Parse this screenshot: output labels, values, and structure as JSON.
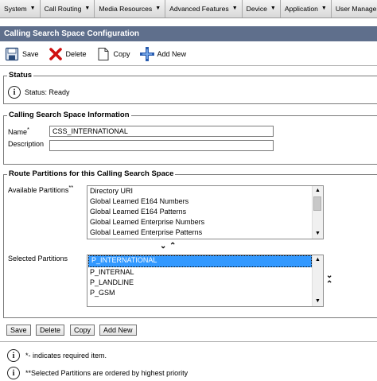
{
  "menu": {
    "items": [
      {
        "label": "System"
      },
      {
        "label": "Call Routing"
      },
      {
        "label": "Media Resources"
      },
      {
        "label": "Advanced Features"
      },
      {
        "label": "Device"
      },
      {
        "label": "Application"
      },
      {
        "label": "User Managem"
      }
    ]
  },
  "page_title": "Calling Search Space Configuration",
  "toolbar": {
    "save": "Save",
    "delete": "Delete",
    "copy": "Copy",
    "add_new": "Add New"
  },
  "status": {
    "heading": "Status",
    "text": "Status: Ready"
  },
  "css_info": {
    "heading": "Calling Search Space Information",
    "name_label": "Name",
    "name_required": "*",
    "name_value": "CSS_INTERNATIONAL",
    "description_label": "Description",
    "description_value": ""
  },
  "partitions": {
    "heading": "Route Partitions for this Calling Search Space",
    "available_label": "Available Partitions",
    "available_marker": "**",
    "available": [
      "Directory URI",
      "Global Learned E164 Numbers",
      "Global Learned E164 Patterns",
      "Global Learned Enterprise Numbers",
      "Global Learned Enterprise Patterns"
    ],
    "selected_label": "Selected Partitions",
    "selected": [
      "P_INTERNATIONAL",
      "P_INTERNAL",
      "P_LANDLINE",
      "P_GSM"
    ],
    "selected_highlight_index": 0
  },
  "bottom_buttons": {
    "save": "Save",
    "delete": "Delete",
    "copy": "Copy",
    "add_new": "Add New"
  },
  "notes": {
    "note1": "*- indicates required item.",
    "note2": "**Selected Partitions are ordered by highest priority"
  },
  "colors": {
    "title_bar": "#5f6f8c",
    "selection": "#3399ff"
  },
  "icons": {
    "down_arrow": "chevron-down",
    "up_arrow": "chevron-up"
  }
}
